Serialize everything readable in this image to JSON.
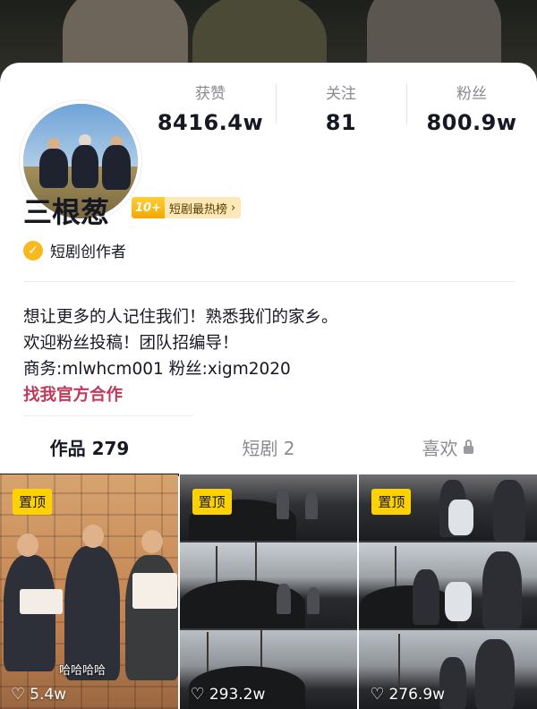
{
  "profile": {
    "name": "三根葱",
    "rank_badge": {
      "number": "10+",
      "label": "短剧最热榜",
      "arrow": "›"
    },
    "creator_tag": "短剧创作者"
  },
  "stats": [
    {
      "label": "获赞",
      "value": "8416.4w"
    },
    {
      "label": "关注",
      "value": "81"
    },
    {
      "label": "粉丝",
      "value": "800.9w"
    }
  ],
  "bio": {
    "lines": [
      "想让更多的人记住我们！熟悉我们的家乡。",
      "欢迎粉丝投稿！团队招编导！",
      "商务:mlwhcm001 粉丝:xigm2020"
    ],
    "link": "找我官方合作"
  },
  "tabs": [
    {
      "label": "作品 279",
      "active": true
    },
    {
      "label": "短剧 2",
      "active": false
    },
    {
      "label": "喜欢",
      "active": false,
      "locked": true
    }
  ],
  "videos": [
    {
      "pin_label": "置顶",
      "likes": "5.4w",
      "caption": "哈哈哈哈"
    },
    {
      "pin_label": "置顶",
      "likes": "293.2w"
    },
    {
      "pin_label": "置顶",
      "likes": "276.9w"
    }
  ],
  "icons": {
    "verified": "check-badge-icon",
    "heart": "heart-outline-icon",
    "lock": "lock-icon"
  },
  "colors": {
    "link": "#c2385a",
    "pin": "#fdd200",
    "verified": "#f8b81e"
  }
}
